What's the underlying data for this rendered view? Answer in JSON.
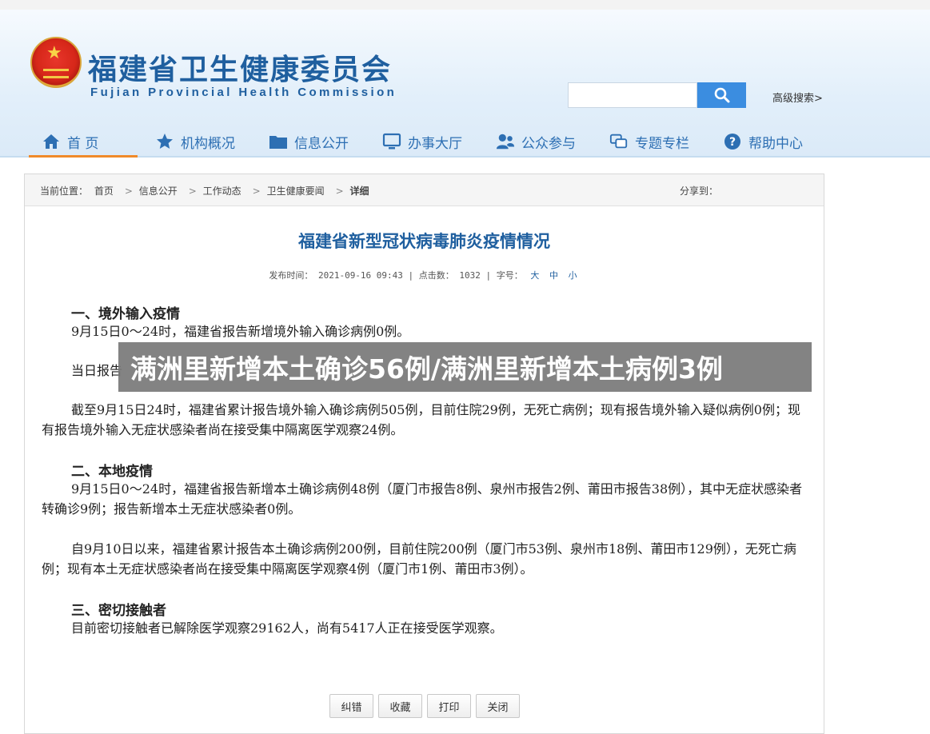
{
  "header": {
    "title": "福建省卫生健康委员会",
    "subtitle": "Fujian Provincial Health Commission",
    "search_placeholder": "",
    "advanced_search": "高级搜索>"
  },
  "nav": [
    {
      "label": "首  页",
      "icon": "home-icon"
    },
    {
      "label": "机构概况",
      "icon": "star-icon"
    },
    {
      "label": "信息公开",
      "icon": "folder-icon"
    },
    {
      "label": "办事大厅",
      "icon": "monitor-icon"
    },
    {
      "label": "公众参与",
      "icon": "people-icon"
    },
    {
      "label": "专题专栏",
      "icon": "chat-icon"
    },
    {
      "label": "帮助中心",
      "icon": "help-icon"
    }
  ],
  "breadcrumb": {
    "prefix": "当前位置：",
    "items": [
      "首页",
      "信息公开",
      "工作动态",
      "卫生健康要闻",
      "详细"
    ],
    "share": "分享到："
  },
  "article": {
    "title": "福建省新型冠状病毒肺炎疫情情况",
    "meta_pub_label": "发布时间：",
    "meta_pub_value": "2021-09-16 09:43",
    "meta_clicks_label": "| 点击数：",
    "meta_clicks_value": "1032",
    "meta_font_label": "| 字号：",
    "font_sizes": [
      "大",
      "中",
      "小"
    ],
    "sections": [
      {
        "heading": "一、境外输入疫情"
      },
      {
        "heading": "二、本地疫情"
      },
      {
        "heading": "三、密切接触者"
      }
    ],
    "paragraphs": [
      "9月15日0～24时，福建省报告新增境外输入确诊病例0例。",
      "当日报告",
      "截至9月15日24时，福建省累计报告境外输入确诊病例505例，目前住院29例，无死亡病例；现有报告境外输入疑似病例0例；现有报告境外输入无症状感染者尚在接受集中隔离医学观察24例。",
      "9月15日0～24时，福建省报告新增本土确诊病例48例（厦门市报告8例、泉州市报告2例、莆田市报告38例），其中无症状感染者转确诊9例；报告新增本土无症状感染者0例。",
      "自9月10日以来，福建省累计报告本土确诊病例200例，目前住院200例（厦门市53例、泉州市18例、莆田市129例），无死亡病例；现有本土无症状感染者尚在接受集中隔离医学观察4例（厦门市1例、莆田市3例）。",
      "目前密切接触者已解除医学观察29162人，尚有5417人正在接受医学观察。"
    ]
  },
  "buttons": [
    "纠错",
    "收藏",
    "打印",
    "关闭"
  ],
  "banner": "满洲里新增本土确诊56例/满洲里新增本土病例3例",
  "colors": {
    "brand": "#1f5f9f",
    "accent": "#f08a2a",
    "search": "#3b8de0"
  }
}
